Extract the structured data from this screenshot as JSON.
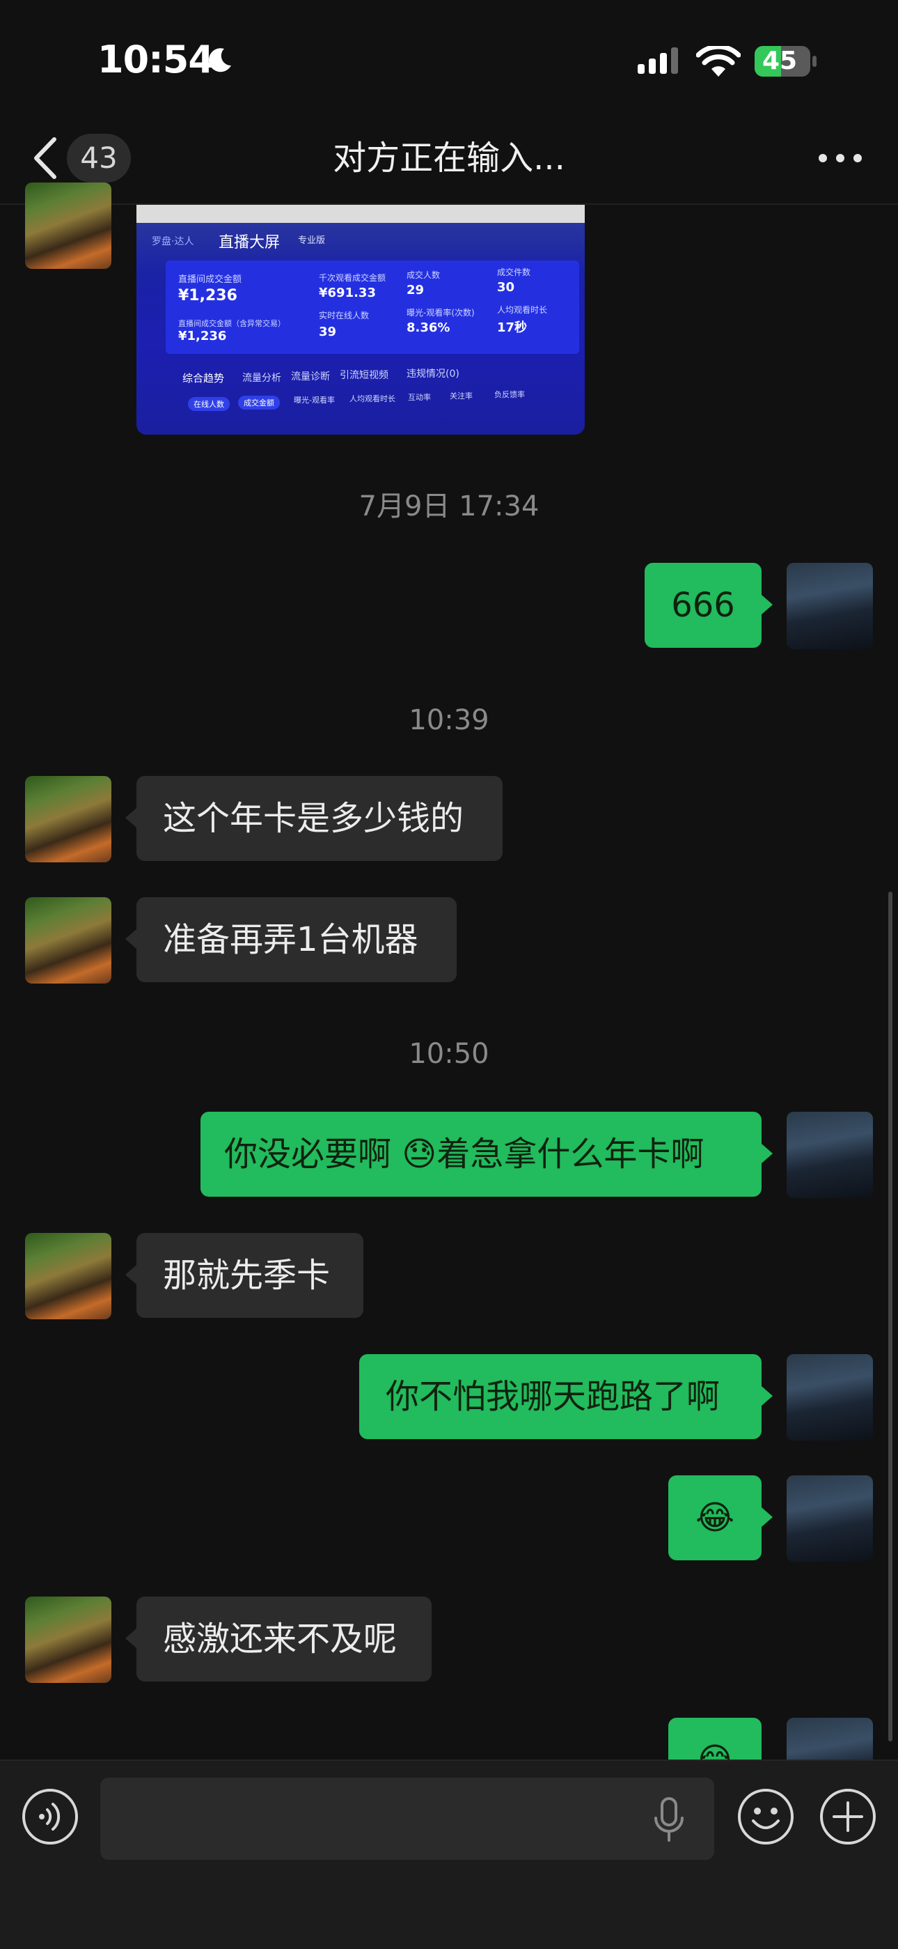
{
  "status_bar": {
    "time": "10:54",
    "battery": "45"
  },
  "header": {
    "unread_count": "43",
    "title": "对方正在输入..."
  },
  "screenshot_preview": {
    "app": "直播大屏",
    "tag": "专业版",
    "brand": "罗盘·达人",
    "metrics": [
      {
        "label": "直播间成交金额",
        "value": "¥1,236"
      },
      {
        "label": "千次观看成交金额",
        "value": "¥691.33"
      },
      {
        "label": "成交人数",
        "value": "29"
      },
      {
        "label": "成交件数",
        "value": "30"
      },
      {
        "label": "直播间成交金额（含异常交易）",
        "value": "¥1,236"
      },
      {
        "label": "实时在线人数",
        "value": "39"
      },
      {
        "label": "曝光-观看率(次数)",
        "value": "8.36%"
      },
      {
        "label": "人均观看时长",
        "value": "17秒"
      }
    ],
    "tabs": [
      "综合趋势",
      "流量分析",
      "流量诊断",
      "引流短视频",
      "违规情况(0)"
    ],
    "pills": [
      "在线人数",
      "成交金额",
      "曝光-观看率",
      "人均观看时长",
      "互动率",
      "关注率",
      "负反馈率"
    ]
  },
  "messages": [
    {
      "type": "time",
      "text": "7月9日 17:34"
    },
    {
      "side": "right",
      "text": "666"
    },
    {
      "type": "time",
      "text": "10:39"
    },
    {
      "side": "left",
      "text": "这个年卡是多少钱的"
    },
    {
      "side": "left",
      "text": "准备再弄1台机器"
    },
    {
      "type": "time",
      "text": "10:50"
    },
    {
      "side": "right",
      "text_before": "你没必要啊 ",
      "emoji": "😓",
      "text_after": "着急拿什么年卡啊"
    },
    {
      "side": "left",
      "text": "那就先季卡"
    },
    {
      "side": "right",
      "text": "你不怕我哪天跑路了啊"
    },
    {
      "side": "right",
      "emoji": "😂"
    },
    {
      "side": "left",
      "text": "感激还来不及呢"
    },
    {
      "side": "right",
      "emoji": "😂"
    }
  ],
  "colors": {
    "background": "#111111",
    "outgoing_bubble": "#22bb5d",
    "incoming_bubble": "#2c2c2c"
  }
}
